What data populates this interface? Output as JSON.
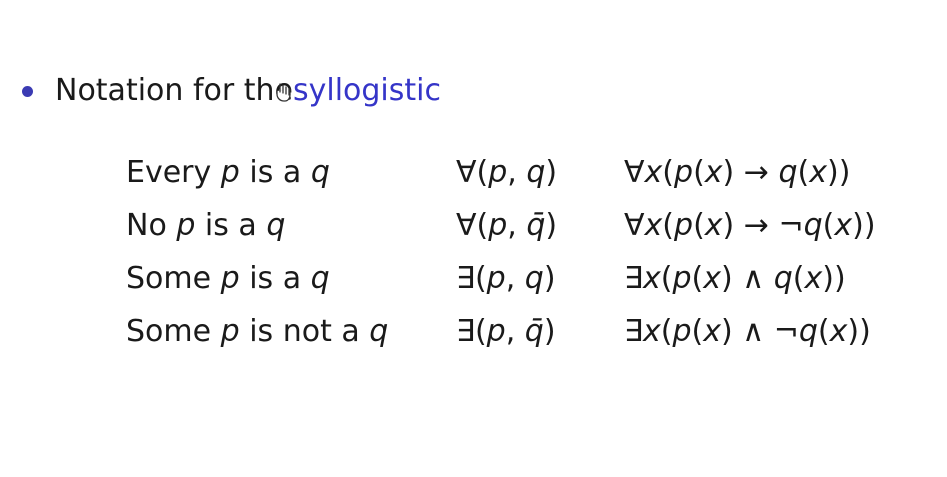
{
  "heading": {
    "prefix": "Notation for the ",
    "accent": "syllogistic",
    "accent_color": "#3535c8",
    "bullet_color": "#3b3bb3"
  },
  "rows": [
    {
      "english": [
        "Every ",
        "p",
        " is a ",
        "q"
      ],
      "short": [
        "∀(",
        "p",
        ", ",
        "q",
        ")"
      ],
      "formula": [
        "∀",
        "x",
        "(",
        "p",
        "(",
        "x",
        ") → ",
        "q",
        "(",
        "x",
        "))"
      ]
    },
    {
      "english": [
        "No ",
        "p",
        " is a ",
        "q"
      ],
      "short": [
        "∀(",
        "p",
        ", ",
        "q̄",
        ")"
      ],
      "formula": [
        "∀",
        "x",
        "(",
        "p",
        "(",
        "x",
        ") → ¬",
        "q",
        "(",
        "x",
        "))"
      ]
    },
    {
      "english": [
        "Some ",
        "p",
        " is a ",
        "q"
      ],
      "short": [
        "∃(",
        "p",
        ", ",
        "q",
        ")"
      ],
      "formula": [
        "∃",
        "x",
        "(",
        "p",
        "(",
        "x",
        ") ∧ ",
        "q",
        "(",
        "x",
        "))"
      ]
    },
    {
      "english": [
        "Some ",
        "p",
        " is not a ",
        "q"
      ],
      "short": [
        "∃(",
        "p",
        ", ",
        "q̄",
        ")"
      ],
      "formula": [
        "∃",
        "x",
        "(",
        "p",
        "(",
        "x",
        ") ∧ ¬",
        "q",
        "(",
        "x",
        "))"
      ]
    }
  ]
}
